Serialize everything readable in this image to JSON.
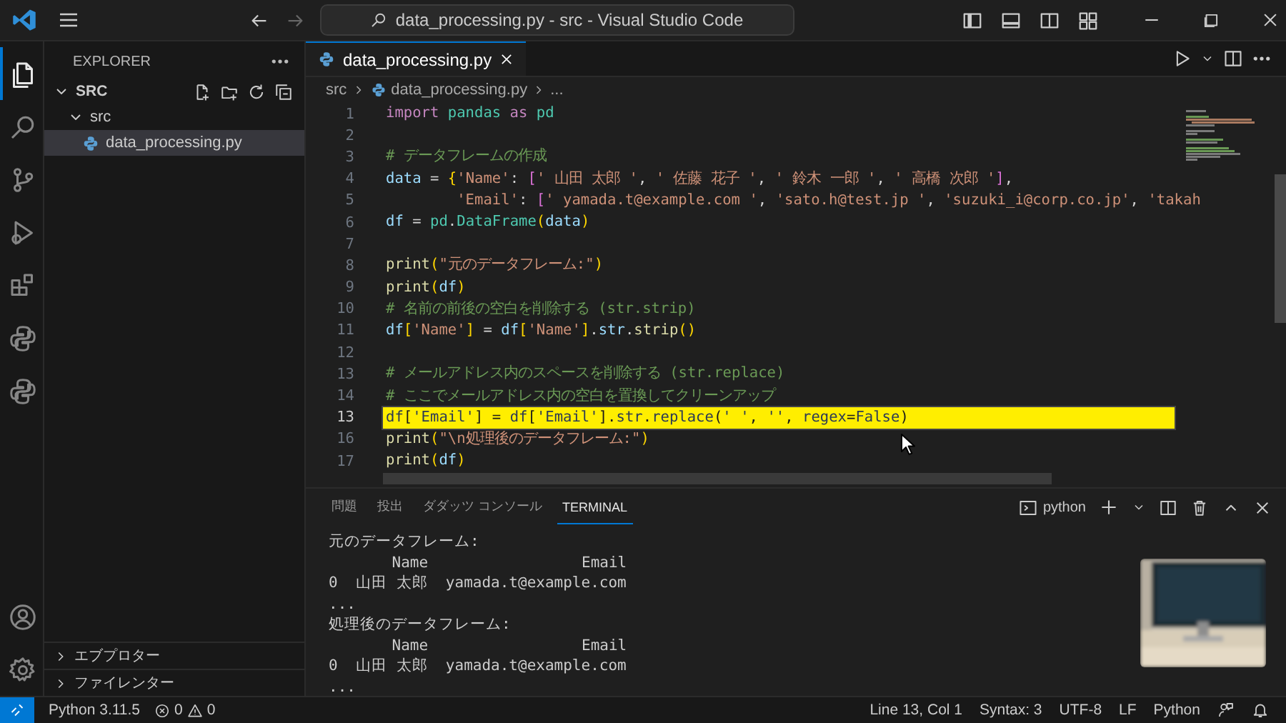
{
  "titlebar": {
    "title": "data_processing.py - src - Visual Studio Code"
  },
  "activity_bar": [
    {
      "kind": "files",
      "selected": true
    },
    {
      "kind": "search",
      "selected": false
    },
    {
      "kind": "source-control",
      "selected": false
    },
    {
      "kind": "run-debug",
      "selected": false
    },
    {
      "kind": "extensions",
      "selected": false
    },
    {
      "kind": "python",
      "selected": false
    },
    {
      "kind": "python",
      "selected": false
    }
  ],
  "activity_bar_bottom": [
    {
      "kind": "account"
    },
    {
      "kind": "settings"
    }
  ],
  "sidebar": {
    "title": "EXPLORER",
    "folder": {
      "label": "SRC",
      "expanded": true
    },
    "tree": [
      {
        "label": "src",
        "kind": "folder",
        "expanded": true,
        "selected": false,
        "children": [
          {
            "label": "data_processing.py",
            "kind": "python-file",
            "selected": true
          }
        ]
      }
    ],
    "sections": [
      {
        "label": "エブプロター",
        "expanded": false
      },
      {
        "label": "ファイレンター",
        "expanded": false
      }
    ]
  },
  "editor": {
    "tabs": [
      {
        "label": "data_processing.py",
        "selected": true
      }
    ],
    "breadcrumb": [
      "src",
      "data_processing.py",
      "..."
    ],
    "code_lines": [
      {
        "number": "1",
        "highlighted": false,
        "tokens": [
          {
            "kind": "kw",
            "text": "import"
          },
          {
            "kind": "cls",
            "text": " pandas"
          },
          {
            "kind": "kw",
            "text": " as"
          },
          {
            "kind": "cls",
            "text": " pd"
          }
        ]
      },
      {
        "number": "2",
        "highlighted": false
      },
      {
        "number": "3",
        "highlighted": false,
        "tokens": [
          {
            "kind": "comment",
            "text": "# データフレームの作成"
          }
        ]
      },
      {
        "number": "4",
        "highlighted": false,
        "tokens": [
          {
            "kind": "name",
            "text": "data"
          },
          {
            "kind": "p",
            "text": " = "
          },
          {
            "kind": "br",
            "text": "{"
          },
          {
            "kind": "str",
            "text": "'Name'"
          },
          {
            "kind": "p",
            "text": ": "
          },
          {
            "kind": "br2",
            "text": "["
          },
          {
            "kind": "str",
            "text": "' 山田 太郎 '"
          },
          {
            "kind": "p",
            "text": ", "
          },
          {
            "kind": "str",
            "text": "' 佐藤 花子 '"
          },
          {
            "kind": "p",
            "text": ", "
          },
          {
            "kind": "str",
            "text": "' 鈴木 一郎 '"
          },
          {
            "kind": "p",
            "text": ", "
          },
          {
            "kind": "str",
            "text": "' 高橋 次郎 '"
          },
          {
            "kind": "br2",
            "text": "]"
          },
          {
            "kind": "p",
            "text": ","
          }
        ]
      },
      {
        "number": "5",
        "highlighted": false,
        "tokens": [
          {
            "kind": "str",
            "text": "        'Email'"
          },
          {
            "kind": "p",
            "text": ": "
          },
          {
            "kind": "br2",
            "text": "["
          },
          {
            "kind": "str",
            "text": "' yamada.t@example.com '"
          },
          {
            "kind": "p",
            "text": ", "
          },
          {
            "kind": "str",
            "text": "'sato.h@test.jp '"
          },
          {
            "kind": "p",
            "text": ", "
          },
          {
            "kind": "str",
            "text": "'suzuki_i@corp.co.jp'"
          },
          {
            "kind": "p",
            "text": ", "
          },
          {
            "kind": "str",
            "text": "'takah"
          }
        ]
      },
      {
        "number": "6",
        "highlighted": false,
        "tokens": [
          {
            "kind": "name",
            "text": "df"
          },
          {
            "kind": "p",
            "text": " = "
          },
          {
            "kind": "cls",
            "text": "pd"
          },
          {
            "kind": "p",
            "text": "."
          },
          {
            "kind": "cls",
            "text": "DataFrame"
          },
          {
            "kind": "br",
            "text": "("
          },
          {
            "kind": "name",
            "text": "data"
          },
          {
            "kind": "br",
            "text": ")"
          }
        ]
      },
      {
        "number": "7",
        "highlighted": false
      },
      {
        "number": "8",
        "highlighted": false,
        "tokens": [
          {
            "kind": "fn",
            "text": "print"
          },
          {
            "kind": "br",
            "text": "("
          },
          {
            "kind": "str",
            "text": "\"元のデータフレーム:\""
          },
          {
            "kind": "br",
            "text": ")"
          }
        ]
      },
      {
        "number": "9",
        "highlighted": false,
        "tokens": [
          {
            "kind": "fn",
            "text": "print"
          },
          {
            "kind": "br",
            "text": "("
          },
          {
            "kind": "name",
            "text": "df"
          },
          {
            "kind": "br",
            "text": ")"
          }
        ]
      },
      {
        "number": "10",
        "highlighted": false,
        "tokens": [
          {
            "kind": "comment",
            "text": "# 名前の前後の空白を削除する (str.strip)"
          }
        ]
      },
      {
        "number": "11",
        "highlighted": false,
        "tokens": [
          {
            "kind": "name",
            "text": "df"
          },
          {
            "kind": "br",
            "text": "["
          },
          {
            "kind": "str",
            "text": "'Name'"
          },
          {
            "kind": "br",
            "text": "]"
          },
          {
            "kind": "p",
            "text": " = "
          },
          {
            "kind": "name",
            "text": "df"
          },
          {
            "kind": "br",
            "text": "["
          },
          {
            "kind": "str",
            "text": "'Name'"
          },
          {
            "kind": "br",
            "text": "]"
          },
          {
            "kind": "p",
            "text": "."
          },
          {
            "kind": "name",
            "text": "str"
          },
          {
            "kind": "p",
            "text": "."
          },
          {
            "kind": "fn",
            "text": "strip"
          },
          {
            "kind": "br",
            "text": "()"
          }
        ]
      },
      {
        "number": "12",
        "highlighted": false
      },
      {
        "number": "13",
        "highlighted": false,
        "tokens": [
          {
            "kind": "comment",
            "text": "# メールアドレス内のスペースを削除する (str.replace)"
          }
        ]
      },
      {
        "number": "14",
        "highlighted": false,
        "tokens": [
          {
            "kind": "comment",
            "text": "# ここでメールアドレス内の空白を置換してクリーンアップ"
          }
        ]
      },
      {
        "number": "13",
        "highlighted": true,
        "tokens": [
          {
            "kind": "name",
            "text": "df"
          },
          {
            "kind": "br",
            "text": "["
          },
          {
            "kind": "str",
            "text": "'Email'"
          },
          {
            "kind": "br",
            "text": "]"
          },
          {
            "kind": "p",
            "text": " = "
          },
          {
            "kind": "name",
            "text": "df"
          },
          {
            "kind": "br",
            "text": "["
          },
          {
            "kind": "str",
            "text": "'Email'"
          },
          {
            "kind": "br",
            "text": "]"
          },
          {
            "kind": "p",
            "text": "."
          },
          {
            "kind": "name",
            "text": "str"
          },
          {
            "kind": "p",
            "text": "."
          },
          {
            "kind": "fn",
            "text": "replace"
          },
          {
            "kind": "br",
            "text": "("
          },
          {
            "kind": "str",
            "text": "' '"
          },
          {
            "kind": "p",
            "text": ", "
          },
          {
            "kind": "str",
            "text": "''"
          },
          {
            "kind": "p",
            "text": ", "
          },
          {
            "kind": "name",
            "text": "regex"
          },
          {
            "kind": "p",
            "text": "="
          },
          {
            "kind": "bool",
            "text": "False"
          },
          {
            "kind": "br",
            "text": ")"
          }
        ]
      },
      {
        "number": "16",
        "highlighted": false,
        "tokens": [
          {
            "kind": "fn",
            "text": "print"
          },
          {
            "kind": "br",
            "text": "("
          },
          {
            "kind": "str",
            "text": "\"\\n処理後のデータフレーム:\""
          },
          {
            "kind": "br",
            "text": ")"
          }
        ]
      },
      {
        "number": "17",
        "highlighted": false,
        "tokens": [
          {
            "kind": "fn",
            "text": "print"
          },
          {
            "kind": "br",
            "text": "("
          },
          {
            "kind": "name",
            "text": "df"
          },
          {
            "kind": "br",
            "text": ")"
          }
        ]
      }
    ]
  },
  "panel": {
    "tabs": [
      {
        "label": "問題",
        "selected": false
      },
      {
        "label": "投出",
        "selected": false
      },
      {
        "label": "ダダッツ コンソール",
        "selected": false
      },
      {
        "label": "TERMINAL",
        "selected": true
      }
    ],
    "terminal_name": "python",
    "terminal_lines": [
      "元のデータフレーム:",
      "       Name                 Email",
      "0  山田 太郎  yamada.t@example.com",
      "...",
      "処理後のデータフレーム:",
      "       Name                 Email",
      "0  山田 太郎  yamada.t@example.com",
      "..."
    ]
  },
  "status_bar": {
    "interpreter": "Python 3.11.5",
    "errors": "0",
    "warnings": "0",
    "right": [
      "Line 13, Col 1",
      "Syntax: 3",
      "UTF-8",
      "LF",
      "Python"
    ]
  }
}
